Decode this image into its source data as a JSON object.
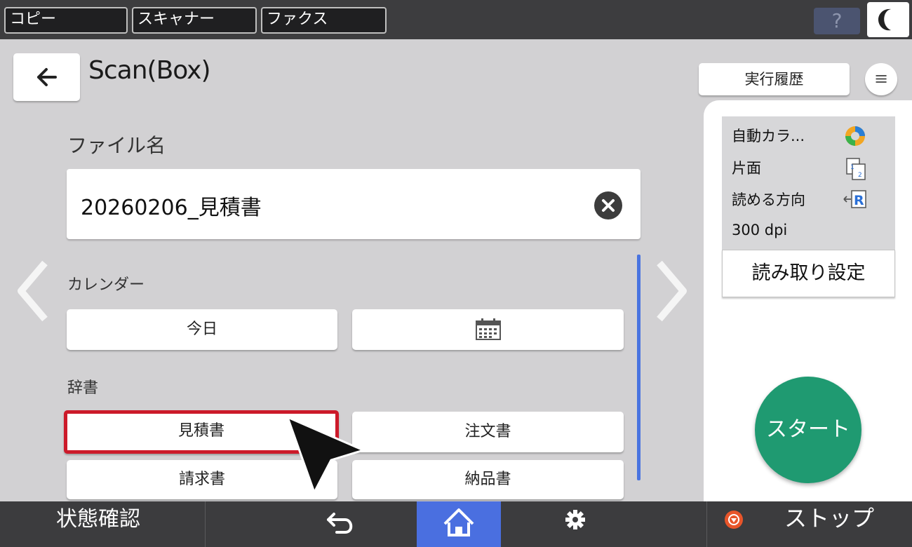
{
  "topbar": {
    "tabs": [
      "コピー",
      "スキャナー",
      "ファクス"
    ],
    "help_label": "?"
  },
  "header": {
    "title": "Scan(Box)",
    "history_label": "実行履歴",
    "menu_label": "≡"
  },
  "filename": {
    "label": "ファイル名",
    "value": "20260206_見積書"
  },
  "calendar": {
    "label": "カレンダー",
    "today_label": "今日"
  },
  "dictionary": {
    "label": "辞書",
    "items": [
      "見積書",
      "注文書",
      "請求書",
      "納品書"
    ],
    "selected": "見積書"
  },
  "summary": {
    "color": "自動カラ...",
    "sides": "片面",
    "orientation": "読める方向",
    "resolution": "300 dpi",
    "settings_label": "読み取り設定"
  },
  "start_label": "スタート",
  "bottombar": {
    "status_label": "状態確認",
    "stop_label": "ストップ"
  },
  "colors": {
    "accent_blue": "#4a6fe0",
    "start_green": "#1f9a71",
    "highlight_red": "#cc1a2a",
    "stop_orange": "#e8552a"
  },
  "icons": [
    "back-arrow-icon",
    "clear-icon",
    "calendar-icon",
    "color-mode-icon",
    "simplex-icon",
    "orientation-icon",
    "undo-icon",
    "home-icon",
    "gear-icon",
    "stop-icon",
    "moon-icon",
    "chevron-left-icon",
    "chevron-right-icon"
  ]
}
